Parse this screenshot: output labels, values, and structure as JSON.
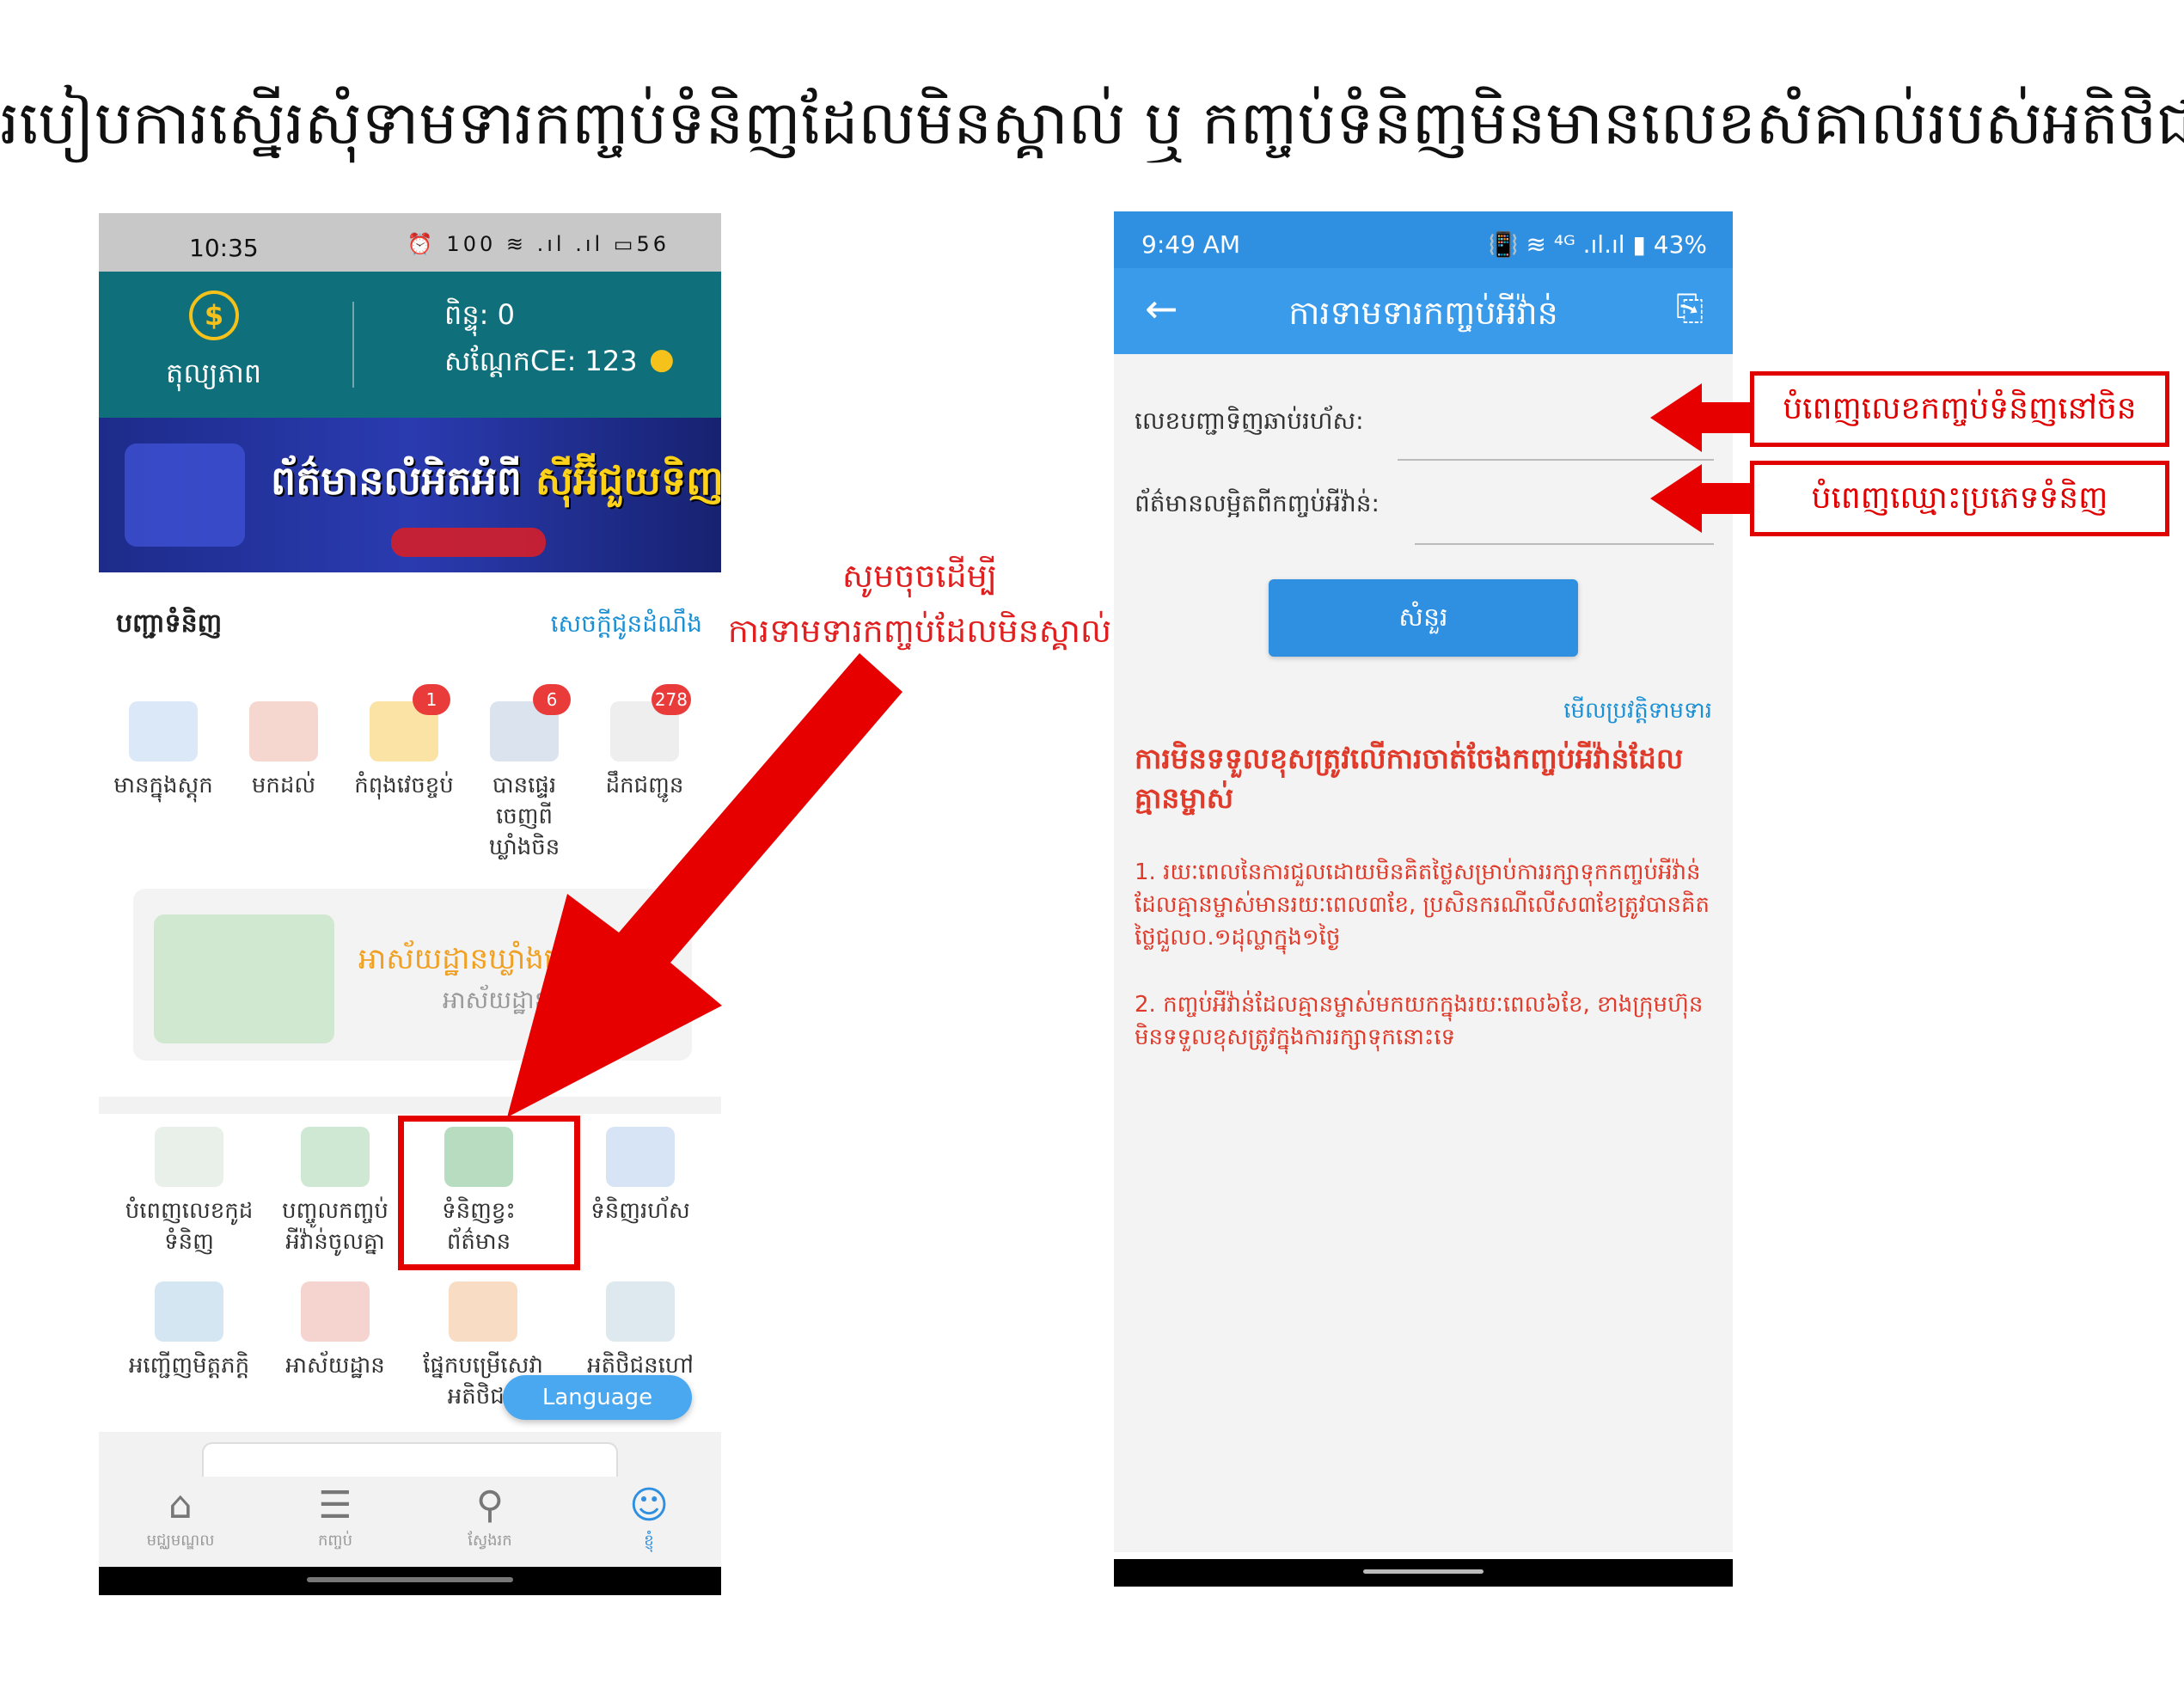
{
  "title": "របៀបការស្នើរសុំទាមទារកញ្ចប់ទំនិញដែលមិនស្គាល់ ឬ កញ្ចប់ទំនិញមិនមានលេខសំគាល់របស់អតិថិជន",
  "left_phone": {
    "status": {
      "time": "10:35",
      "icons": "⏰ 100 ≋ .ıl .ıl ▭56"
    },
    "header": {
      "balance_label": "តុល្យភាព",
      "points": "ពិន្ទុ: 0",
      "coupon": "សណ្តែកCE: 123",
      "coin_icon": "$"
    },
    "banner": {
      "text_a": "ព័ត៌មានលំអិតអំពី",
      "text_b": "ស៊ីអ៊ីជួយទិញ"
    },
    "list_header": {
      "title": "បញ្ជាទំនិញ",
      "link": "សេចក្តីជូនដំណឹង"
    },
    "grid1": [
      {
        "label": "មានក្នុងស្តុក",
        "icon": "truck-icon",
        "badge": ""
      },
      {
        "label": "មកដល់",
        "icon": "delivered-truck-icon",
        "badge": ""
      },
      {
        "label": "កំពុងវេចខ្ចប់",
        "icon": "package-icon",
        "badge": "1"
      },
      {
        "label": "បានផ្ទេរចេញពីឃ្លាំងចិន",
        "icon": "ship-icon",
        "badge": "6"
      },
      {
        "label": "ដឹកជញ្ជូន",
        "icon": "document-icon",
        "badge": "278"
      }
    ],
    "warehouse": {
      "title": "អាស័យដ្ឋានឃ្លាំងនៅប្រ",
      "subtitle": "អាស័យដ្ឋាន"
    },
    "grid2": [
      {
        "label": "បំពេញលេខកូដទំនិញ",
        "icon": "add-document-icon"
      },
      {
        "label": "បញ្ចូលកញ្ចប់អីវ៉ាន់ចូលគ្នា",
        "icon": "certificate-icon"
      },
      {
        "label": "ទំនិញខ្វះព័ត៌មាន",
        "icon": "box-icon"
      },
      {
        "label": "ទំនិញរហ័ស",
        "icon": "fast-truck-icon"
      },
      {
        "label": "អញ្ជើញមិត្តភក្តិ",
        "icon": "friends-icon"
      },
      {
        "label": "អាស័យដ្ឋាន",
        "icon": "location-icon"
      },
      {
        "label": "ផ្នែកបម្រើសេវាអតិថិជន",
        "icon": "support-agent-icon"
      },
      {
        "label": "អតិថិជនហៅ",
        "icon": "feedback-icon"
      }
    ],
    "language_button": "Language",
    "nav": [
      {
        "label": "មជ្ឈមណ្ឌល",
        "icon": "home-icon"
      },
      {
        "label": "កញ្ចប់",
        "icon": "list-icon"
      },
      {
        "label": "ស្វែងរក",
        "icon": "search-icon"
      },
      {
        "label": "ខ្ញុំ",
        "icon": "user-icon"
      }
    ]
  },
  "annotation": {
    "line1": "សូមចុចដើម្បី",
    "line2": "ការទាមទារកញ្ចប់ដែលមិនស្គាល់",
    "color": "#e00000"
  },
  "right_phone": {
    "status": {
      "time": "9:49 AM",
      "right": "📳 ≋ ⁴ᴳ .ıl.ıl ▮ 43%"
    },
    "appbar": {
      "title": "ការទាមទារកញ្ចប់អីវ៉ាន់",
      "back_icon": "←",
      "action_icon": "⎘"
    },
    "field1_label": "លេខបញ្ជាទិញឆាប់រហ័ស:",
    "field2_label": "ព័ត៌មានលម្អិតពីកញ្ចប់អីវ៉ាន់:",
    "submit": "សំនួរ",
    "history_link": "មើលប្រវត្តិទាមទារ",
    "warning_title": "ការមិនទទួលខុសត្រូវលើការចាត់ចែងកញ្ចប់អីវ៉ាន់ដែលគ្មានម្ចាស់",
    "note1": "1. រយៈពេលនៃការជួលដោយមិនគិតថ្លៃសម្រាប់ការរក្សាទុកកញ្ចប់អីវ៉ាន់ដែលគ្មានម្ចាស់មានរយៈពេល៣ខែ, ប្រសិនករណីលើស៣ខែត្រូវបានគិតថ្លៃជួល០.១ដុល្លាក្នុង១ថ្ងៃ",
    "note2": "2. កញ្ចប់អីវ៉ាន់ដែលគ្មានម្ចាស់មកយកក្នុងរយៈពេល៦ខែ, ខាងក្រុមហ៊ុនមិនទទួលខុសត្រូវក្នុងការរក្សាទុកនោះទេ"
  },
  "callouts": {
    "c1": "បំពេញលេខកញ្ចប់ទំនិញនៅចិន",
    "c2": "បំពេញឈ្មោះប្រភេទទំនិញ"
  },
  "colors": {
    "accent_red": "#e00000",
    "app_blue": "#3a9bea",
    "teal_header": "#0f6f7a"
  }
}
